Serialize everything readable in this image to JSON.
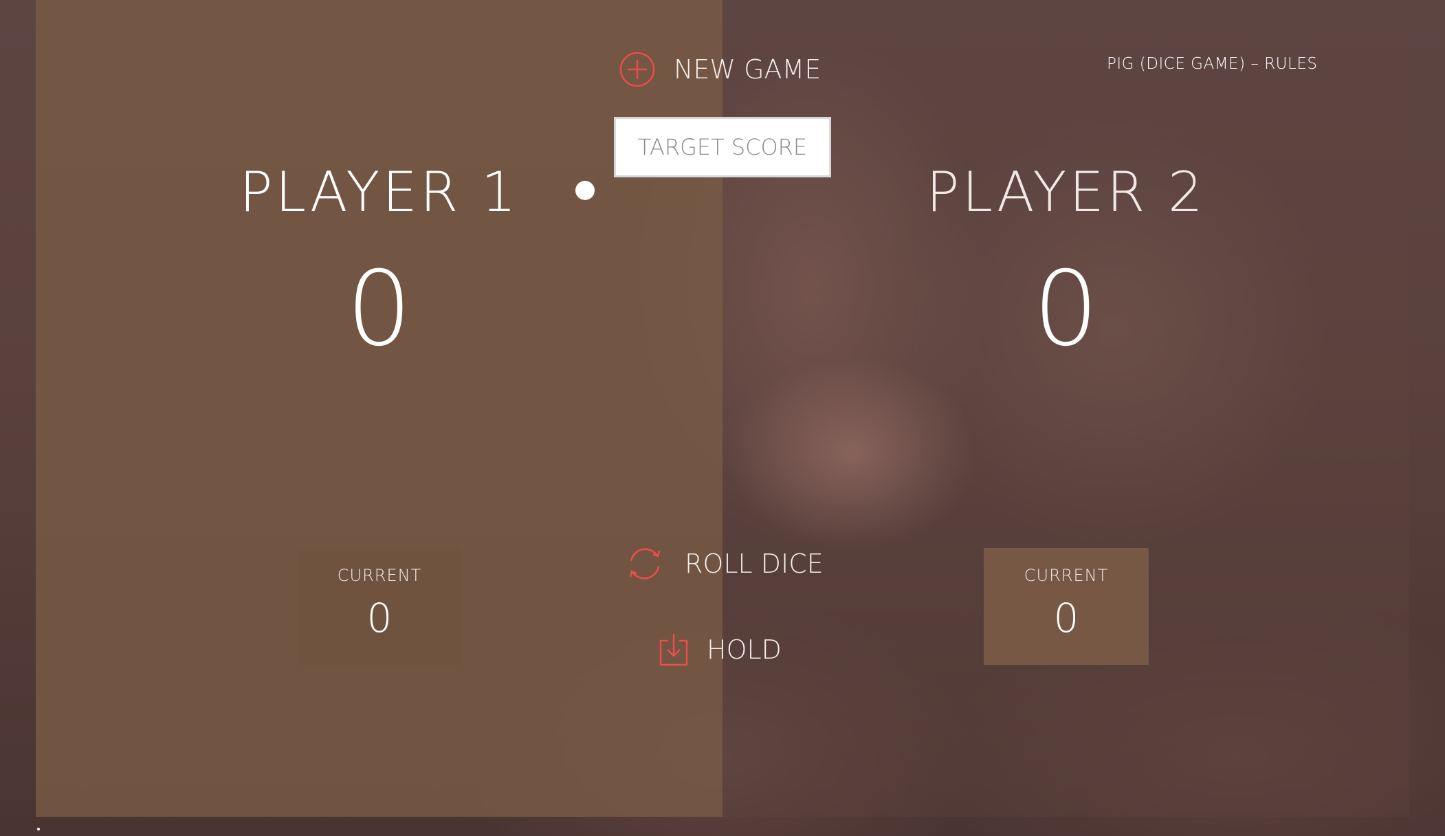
{
  "players": [
    {
      "name": "PLAYER 1",
      "score": "0",
      "current_label": "CURRENT",
      "current_score": "0",
      "active": true
    },
    {
      "name": "PLAYER 2",
      "score": "0",
      "current_label": "CURRENT",
      "current_score": "0",
      "active": false
    }
  ],
  "controls": {
    "new_game_label": "NEW GAME",
    "roll_dice_label": "ROLL DICE",
    "hold_label": "HOLD",
    "target_score_placeholder": "TARGET SCORE"
  },
  "rules_link": "PIG (DICE GAME) – RULES",
  "icons": {
    "new_game": "plus-circle-icon",
    "roll_dice": "refresh-icon",
    "hold": "download-icon"
  },
  "colors": {
    "accent": "#eb4d4b",
    "active_panel": "#785a44",
    "text": "#ffffff"
  }
}
